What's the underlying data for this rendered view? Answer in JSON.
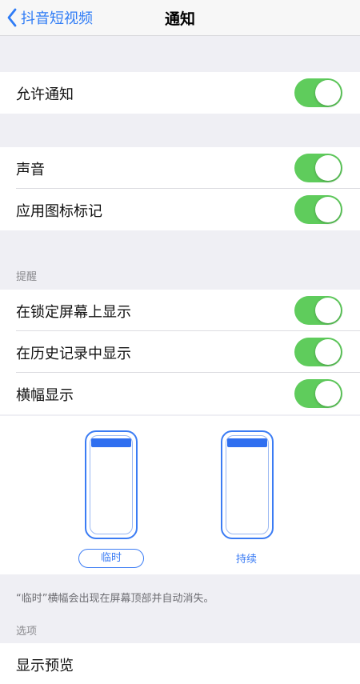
{
  "navbar": {
    "back_label": "抖音短视频",
    "title": "通知"
  },
  "rows": {
    "allow": "允许通知",
    "sound": "声音",
    "badge": "应用图标标记",
    "lock_screen": "在锁定屏幕上显示",
    "history": "在历史记录中显示",
    "banner": "横幅显示",
    "preview": "显示预览"
  },
  "toggles": {
    "allow": true,
    "sound": true,
    "badge": true,
    "lock_screen": true,
    "history": true,
    "banner": true
  },
  "sections": {
    "alerts": "提醒",
    "options": "选项"
  },
  "banner_styles": {
    "temporary": "临时",
    "persistent": "持续",
    "selected": "临时"
  },
  "footnote": "“临时”横幅会出现在屏幕顶部并自动消失。",
  "colors": {
    "toggle_on": "#5fcc5c",
    "accent": "#3b7cf4",
    "group_bg": "#efeff4"
  }
}
